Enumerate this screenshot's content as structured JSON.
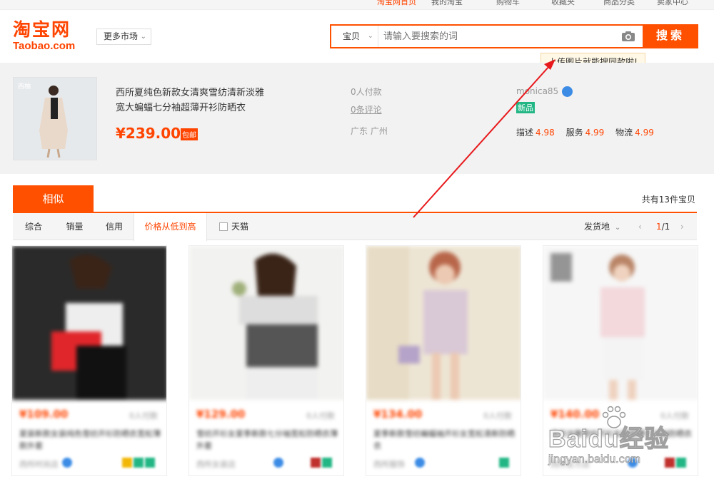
{
  "topbar": {
    "items": [
      "淘宝网首页",
      "我的淘宝",
      "购物车",
      "收藏夹",
      "商品分类",
      "卖家中心"
    ]
  },
  "logo": {
    "cn": "淘宝网",
    "en": "Taobao.com"
  },
  "header": {
    "more_market": "更多市场"
  },
  "search": {
    "type": "宝贝",
    "placeholder": "请输入要搜索的词",
    "button": "搜索"
  },
  "tooltip": "上传图片就能搜同款啦!",
  "product": {
    "thumb_tag": "西柚",
    "title": "西所夏纯色新款女清爽雪纺清新淡雅宽大蝙蝠七分袖超薄开衫防晒衣",
    "price": "¥239.00",
    "shipping_badge": "包邮",
    "payments": "0人付款",
    "reviews": "0条评论",
    "location": "广东 广州",
    "seller": "monica85",
    "new_badge": "新品",
    "ratings": [
      {
        "label": "描述",
        "value": "4.98"
      },
      {
        "label": "服务",
        "value": "4.99"
      },
      {
        "label": "物流",
        "value": "4.99"
      }
    ]
  },
  "tabs": {
    "similar": "相似",
    "count": "共有13件宝贝"
  },
  "sort": {
    "items": [
      "综合",
      "销量",
      "信用",
      "价格从低到高"
    ],
    "tmall": "天猫",
    "ship_from": "发货地",
    "page_current": "1",
    "page_total": "/1",
    "prev": "‹",
    "next": "›"
  },
  "cards": [
    {
      "price": "¥109.00",
      "sales": "0人付款",
      "title": "夏装新款女装纯色雪纺开衫防晒衣宽松薄款外套",
      "shop": "西所时尚店"
    },
    {
      "price": "¥129.00",
      "sales": "0人付款",
      "title": "雪纺开衫女夏季新款七分袖宽松防晒衣薄外套",
      "shop": "西所女装店"
    },
    {
      "price": "¥134.00",
      "sales": "0人付款",
      "title": "夏季新款雪纺蝙蝠袖开衫女宽松清新防晒衣",
      "shop": "西所服饰"
    },
    {
      "price": "¥140.00",
      "sales": "0人付款",
      "title": "清新淡雅雪纺开衫女夏超薄七分袖防晒衣",
      "shop": "西所官方店"
    }
  ],
  "watermark": {
    "main": "Baidu经验",
    "sub": "jingyan.baidu.com"
  },
  "colors": {
    "accent": "#ff5000",
    "price": "#ff4400",
    "new_badge": "#22b685",
    "annotation_arrow": "#e8191c"
  }
}
